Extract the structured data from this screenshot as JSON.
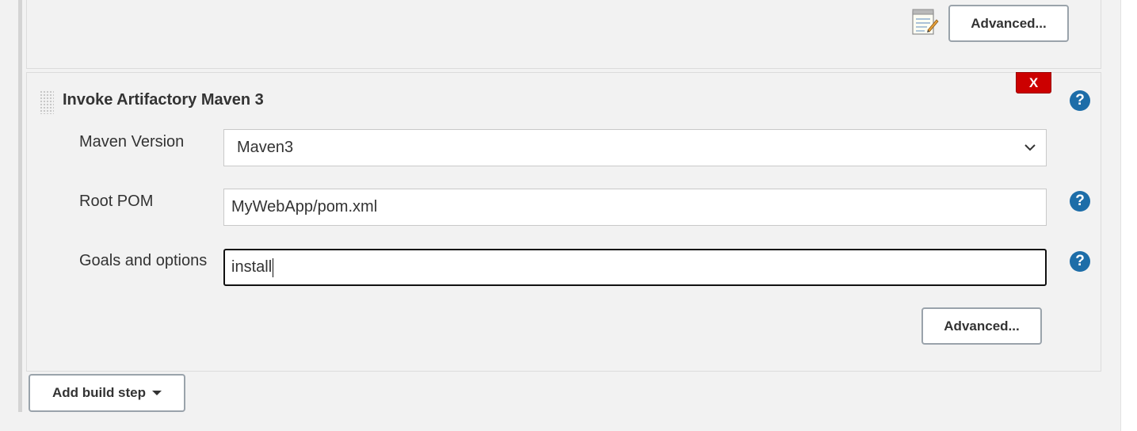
{
  "top_section": {
    "advanced_label": "Advanced..."
  },
  "maven_step": {
    "title": "Invoke Artifactory Maven 3",
    "delete_label": "X",
    "help_glyph": "?",
    "fields": {
      "maven_version": {
        "label": "Maven Version",
        "value": "Maven3"
      },
      "root_pom": {
        "label": "Root POM",
        "value": "MyWebApp/pom.xml"
      },
      "goals": {
        "label": "Goals and options",
        "value": "install"
      }
    },
    "advanced_label": "Advanced..."
  },
  "add_build_step_label": "Add build step",
  "icons": {
    "notepad": "notepad-icon",
    "help": "help-icon",
    "dropdown": "chevron-down-icon",
    "drag": "drag-handle-icon"
  },
  "colors": {
    "delete_red": "#cc0000",
    "help_blue": "#1d6da8",
    "panel_bg": "#f2f2f2"
  }
}
